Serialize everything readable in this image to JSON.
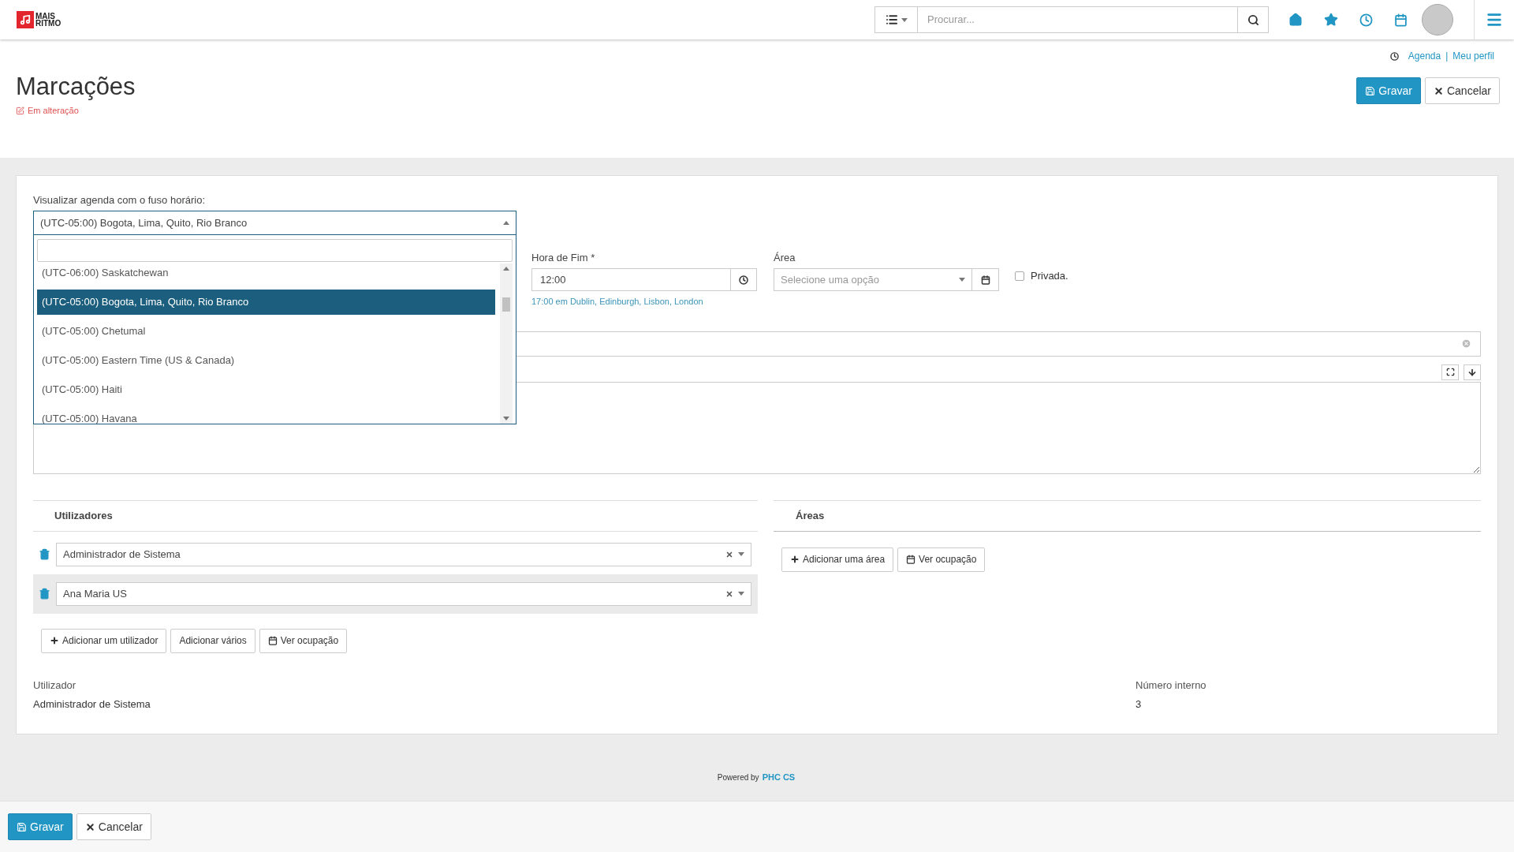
{
  "topbar": {
    "logo": [
      "MAIS",
      "RITMO"
    ],
    "search": {
      "placeholder": "Procurar..."
    }
  },
  "links": {
    "items": [
      "Agenda",
      "Meu perfil"
    ],
    "separator": "|"
  },
  "page": {
    "title": "Marcações",
    "status": "Em alteração"
  },
  "header_buttons": [
    {
      "kind": "primary",
      "label": "Gravar"
    },
    {
      "kind": "default",
      "label": "Cancelar"
    }
  ],
  "timezone": {
    "label": "Visualizar agenda com o fuso horário:",
    "value": "(UTC-05:00) Bogota, Lima, Quito, Rio Branco",
    "expanded": true,
    "options": [
      {
        "label": "(UTC-06:00) Saskatchewan",
        "selected": false
      },
      {
        "label": "(UTC-05:00) Bogota, Lima, Quito, Rio Branco",
        "selected": true
      },
      {
        "label": "(UTC-05:00) Chetumal",
        "selected": false
      },
      {
        "label": "(UTC-05:00) Eastern Time (US & Canada)",
        "selected": false
      },
      {
        "label": "(UTC-05:00) Haiti",
        "selected": false
      },
      {
        "label": "(UTC-05:00) Havana",
        "selected": false
      }
    ]
  },
  "end_time": {
    "label": "Hora de Fim *",
    "value": "12:00",
    "hint": "17:00 em Dublin, Edinburgh, Lisbon, London"
  },
  "area": {
    "label": "Área",
    "placeholder": "Selecione uma opção"
  },
  "private": {
    "label": "Privada.",
    "checked": false
  },
  "users": {
    "title": "Utilizadores",
    "rows": [
      {
        "name": "Administrador de Sistema",
        "highlighted": false
      },
      {
        "name": "Ana Maria US",
        "highlighted": true
      }
    ],
    "buttons": [
      {
        "kind": "add",
        "label": "Adicionar um utilizador"
      },
      {
        "kind": "plain",
        "label": "Adicionar vários"
      },
      {
        "kind": "calendar",
        "label": "Ver ocupação"
      }
    ]
  },
  "areas": {
    "title": "Áreas",
    "buttons": [
      {
        "kind": "add",
        "label": "Adicionar uma área"
      },
      {
        "kind": "calendar",
        "label": "Ver ocupação"
      }
    ]
  },
  "details": [
    {
      "label": "Utilizador",
      "value": "Administrador de Sistema"
    },
    {
      "label": "Número interno",
      "value": "3"
    }
  ],
  "footer": {
    "powered_by": "Powered by",
    "brand": "PHC CS"
  },
  "bottom_buttons": [
    {
      "kind": "primary",
      "label": "Gravar"
    },
    {
      "kind": "default",
      "label": "Cancelar"
    }
  ]
}
